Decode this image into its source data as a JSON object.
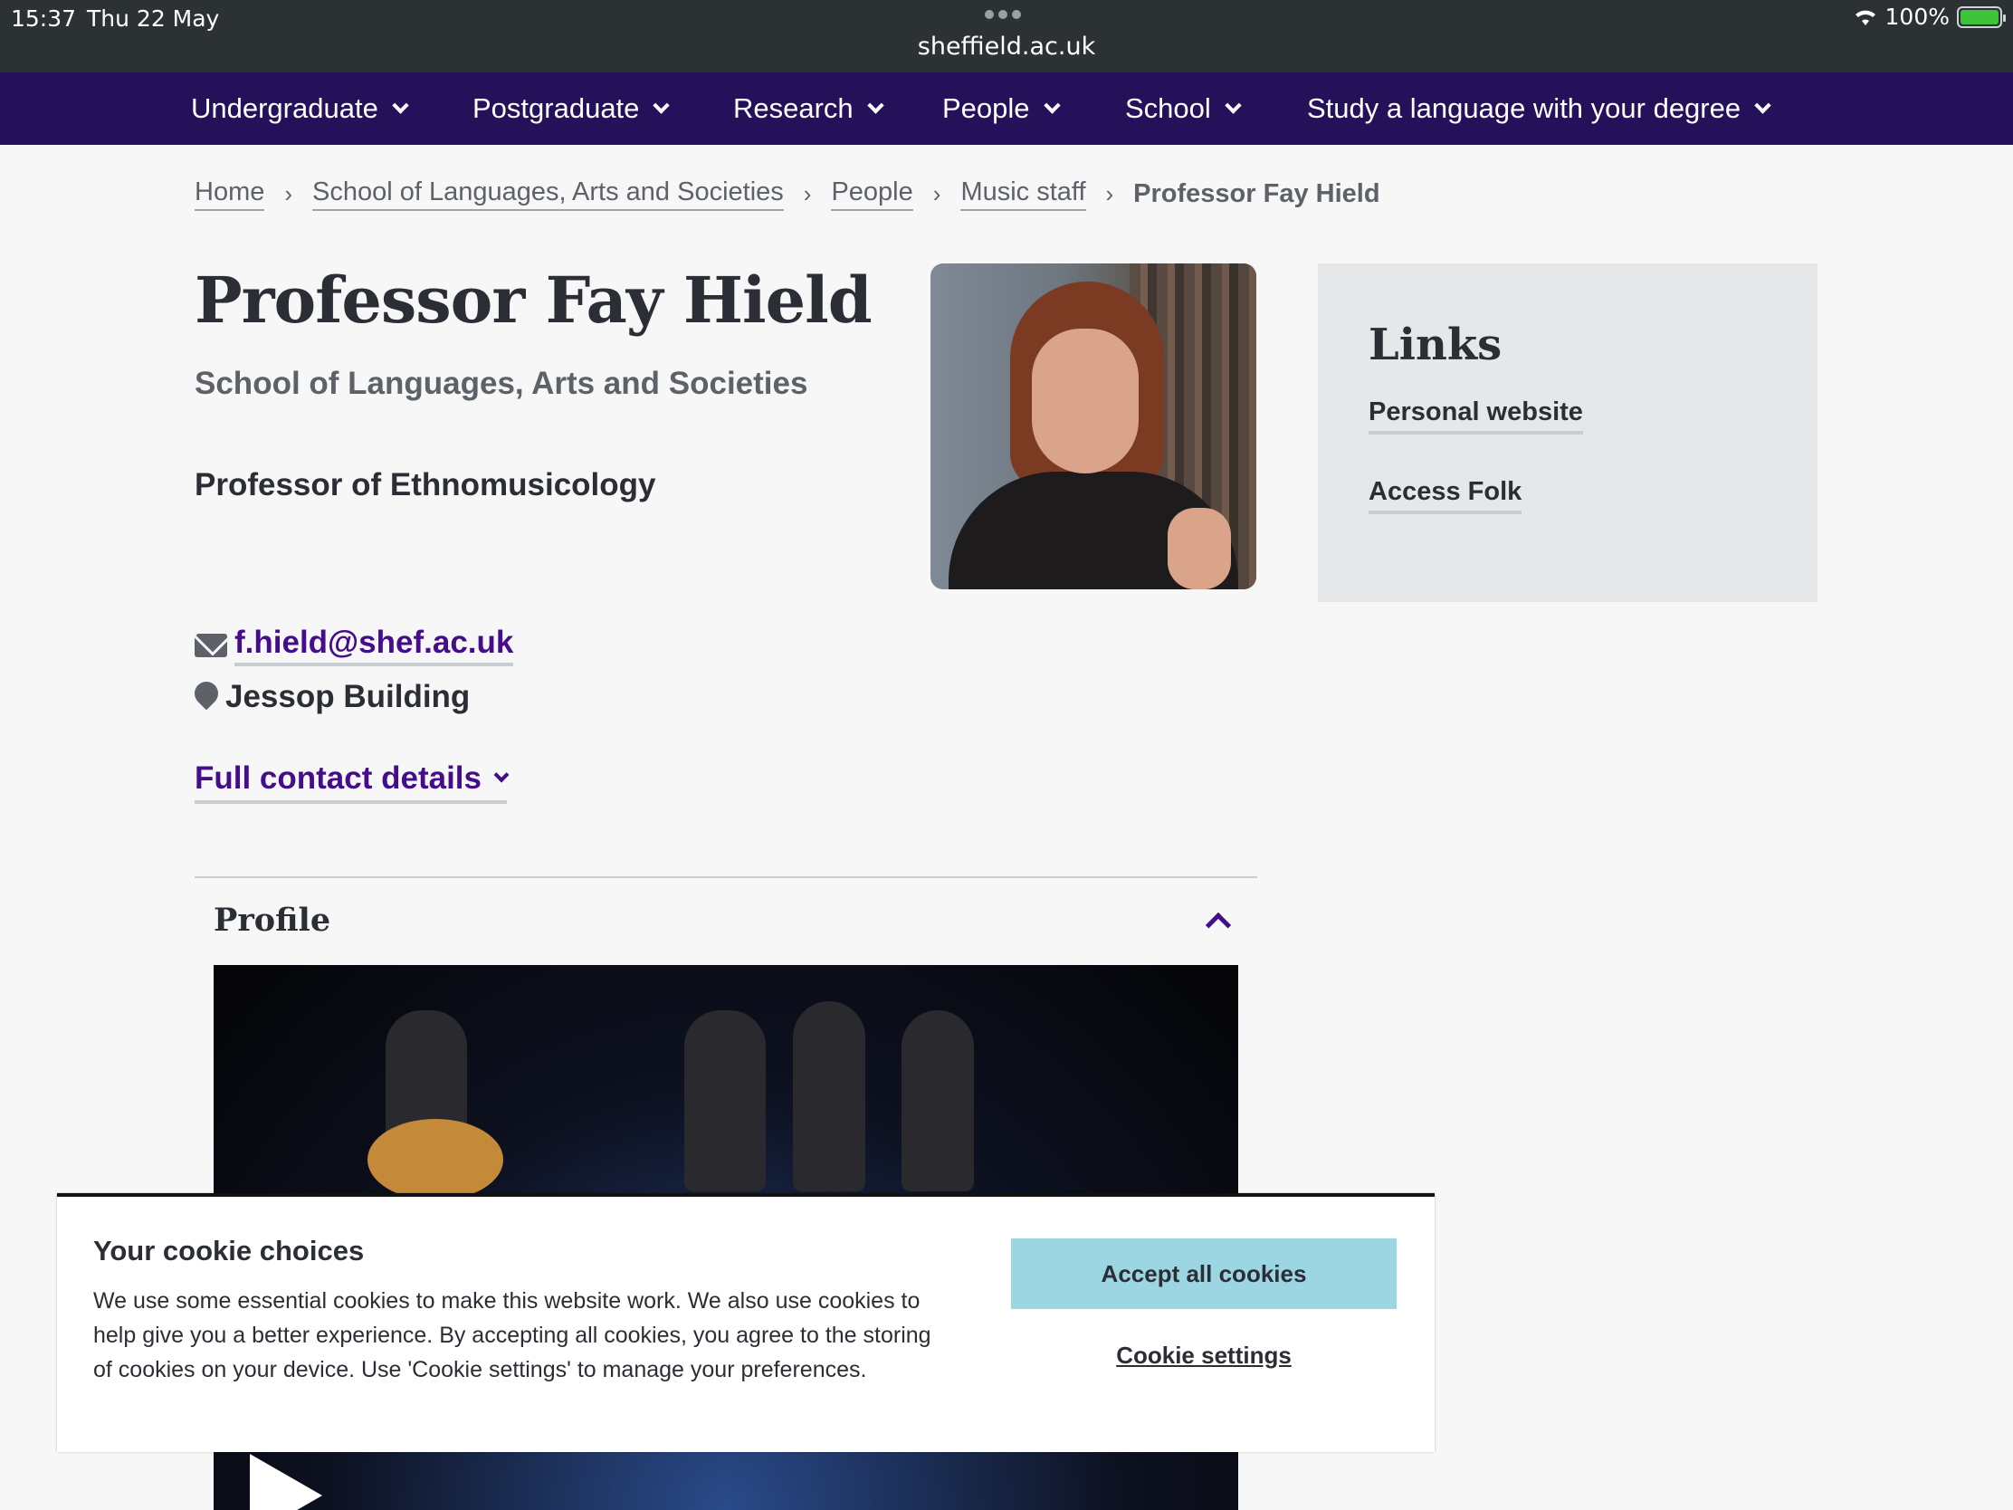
{
  "status_bar": {
    "time": "15:37",
    "date": "Thu 22 May",
    "url": "sheffield.ac.uk",
    "battery": "100%"
  },
  "nav": {
    "items": [
      {
        "label": "Undergraduate"
      },
      {
        "label": "Postgraduate"
      },
      {
        "label": "Research"
      },
      {
        "label": "People"
      },
      {
        "label": "School"
      },
      {
        "label": "Study a language with your degree"
      }
    ]
  },
  "breadcrumb": {
    "items": [
      "Home",
      "School of Languages, Arts and Societies",
      "People",
      "Music staff"
    ],
    "current": "Professor Fay Hield"
  },
  "profile": {
    "name": "Professor Fay Hield",
    "department": "School of Languages, Arts and Societies",
    "role": "Professor of Ethnomusicology",
    "email": "f.hield@shef.ac.uk",
    "building": "Jessop Building",
    "full_contact_label": "Full contact details",
    "section_title": "Profile"
  },
  "links": {
    "title": "Links",
    "items": [
      "Personal website",
      "Access Folk"
    ]
  },
  "cookie": {
    "title": "Your cookie choices",
    "text": "We use some essential cookies to make this website work. We also use cookies to help give you a better experience. By accepting all cookies, you agree to the storing of cookies on your device. Use 'Cookie settings' to manage your preferences.",
    "accept_label": "Accept all cookies",
    "settings_label": "Cookie settings"
  },
  "colors": {
    "nav_bg": "#25105a",
    "link_purple": "#440e8a",
    "accept_bg": "#9dd6e3"
  }
}
